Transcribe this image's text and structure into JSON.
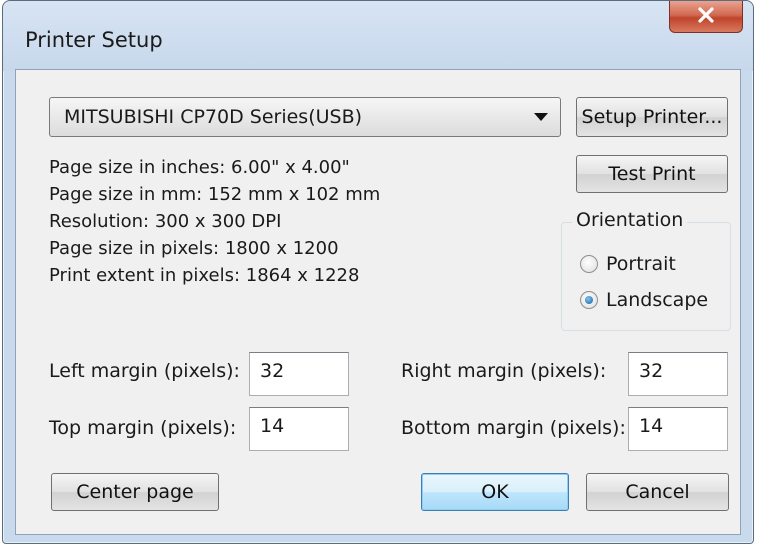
{
  "window": {
    "title": "Printer Setup",
    "close_glyph": "x"
  },
  "printer": {
    "selected": "MITSUBISHI CP70D Series(USB)",
    "setup_label": "Setup Printer...",
    "test_label": "Test Print"
  },
  "info": [
    "Page size in inches: 6.00\" x 4.00\"",
    "Page size in mm: 152 mm x 102 mm",
    "Resolution: 300 x 300 DPI",
    "Page size in pixels: 1800 x 1200",
    "Print extent in pixels: 1864 x 1228"
  ],
  "orientation": {
    "legend": "Orientation",
    "portrait_label": "Portrait",
    "landscape_label": "Landscape",
    "selected": "Landscape"
  },
  "margins": {
    "left_label": "Left margin (pixels):",
    "left_value": "32",
    "right_label": "Right margin (pixels):",
    "right_value": "32",
    "top_label": "Top margin (pixels):",
    "top_value": "14",
    "bottom_label": "Bottom margin (pixels):",
    "bottom_value": "14"
  },
  "buttons": {
    "center_label": "Center page",
    "ok_label": "OK",
    "cancel_label": "Cancel"
  },
  "colors": {
    "accent_default_button": "#3c7fb1",
    "close_button": "#c0442c",
    "radio_selected": "#1a5e97"
  }
}
